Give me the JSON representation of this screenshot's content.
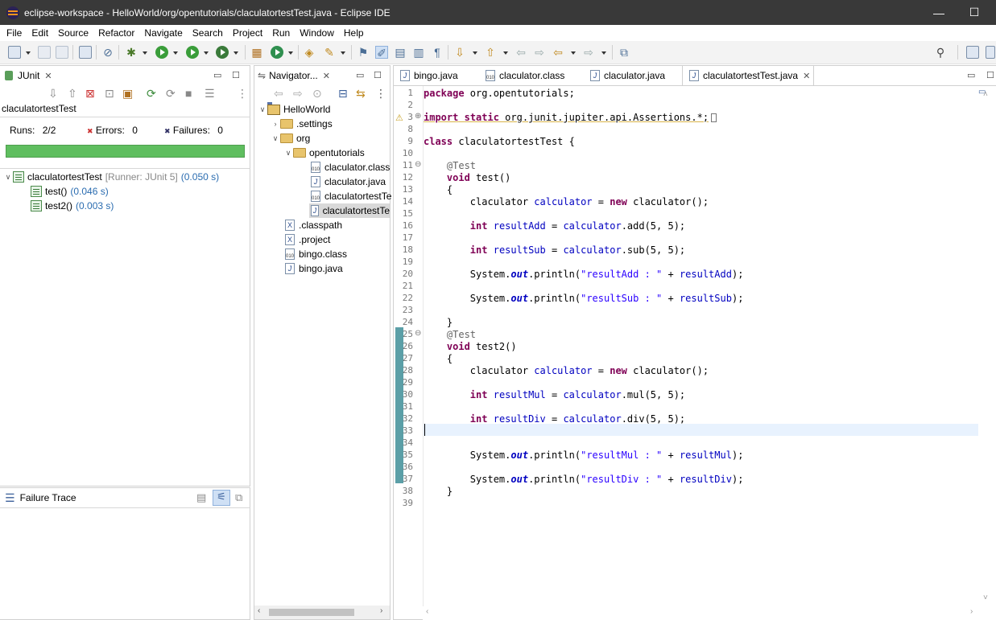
{
  "window": {
    "title": "eclipse-workspace - HelloWorld/org/opentutorials/claculatortestTest.java - Eclipse IDE",
    "minimize": "—",
    "maximize": "☐"
  },
  "menu": [
    "File",
    "Edit",
    "Source",
    "Refactor",
    "Navigate",
    "Search",
    "Project",
    "Run",
    "Window",
    "Help"
  ],
  "junit": {
    "tab": "JUnit",
    "test_class": "claculatortestTest",
    "runs_label": "Runs:",
    "runs": "2/2",
    "errors_label": "Errors:",
    "errors": "0",
    "failures_label": "Failures:",
    "failures": "0",
    "bar_color": "#5fbe5f",
    "tree": {
      "name": "claculatortestTest",
      "runner": "[Runner: JUnit 5]",
      "time": "(0.050 s)",
      "children": [
        {
          "name": "test()",
          "time": "(0.046 s)"
        },
        {
          "name": "test2()",
          "time": "(0.003 s)"
        }
      ]
    },
    "failure_trace": "Failure Trace"
  },
  "navigator": {
    "tab": "Navigator...",
    "items": [
      {
        "label": "HelloWorld"
      },
      {
        "label": ".settings"
      },
      {
        "label": "org"
      },
      {
        "label": "opentutorials"
      },
      {
        "label": "claculator.class"
      },
      {
        "label": "claculator.java"
      },
      {
        "label": "claculatortestTe"
      },
      {
        "label": "claculatortestTe"
      },
      {
        "label": ".classpath"
      },
      {
        "label": ".project"
      },
      {
        "label": "bingo.class"
      },
      {
        "label": "bingo.java"
      }
    ]
  },
  "editor": {
    "tabs": [
      {
        "label": "bingo.java"
      },
      {
        "label": "claculator.class"
      },
      {
        "label": "claculator.java"
      },
      {
        "label": "claculatortestTest.java"
      }
    ],
    "line_numbers": [
      "1",
      "2",
      "3",
      "8",
      "9",
      "10",
      "11",
      "12",
      "13",
      "14",
      "15",
      "16",
      "17",
      "18",
      "19",
      "20",
      "21",
      "22",
      "23",
      "24",
      "25",
      "26",
      "27",
      "28",
      "29",
      "30",
      "31",
      "32",
      "33",
      "34",
      "35",
      "36",
      "37",
      "38",
      "39"
    ],
    "lines": [
      "package org.opentutorials;",
      "",
      "import static org.junit.jupiter.api.Assertions.*;",
      "",
      "class claculatortestTest {",
      "",
      "@Test",
      "void test()",
      "{",
      "claculator calculator = new claculator();",
      "",
      "int resultAdd = calculator.add(5, 5);",
      "",
      "int resultSub = calculator.sub(5, 5);",
      "",
      "System.out.println(\"resultAdd : \" + resultAdd);",
      "",
      "System.out.println(\"resultSub : \" + resultSub);",
      "",
      "}",
      "@Test",
      "void test2()",
      "{",
      "claculator calculator = new claculator();",
      "",
      "int resultMul = calculator.mul(5, 5);",
      "",
      "int resultDiv = calculator.div(5, 5);",
      "",
      "",
      "System.out.println(\"resultMul : \" + resultMul);",
      "",
      "System.out.println(\"resultDiv : \" + resultDiv);",
      "}",
      "",
      "}",
      ""
    ]
  }
}
